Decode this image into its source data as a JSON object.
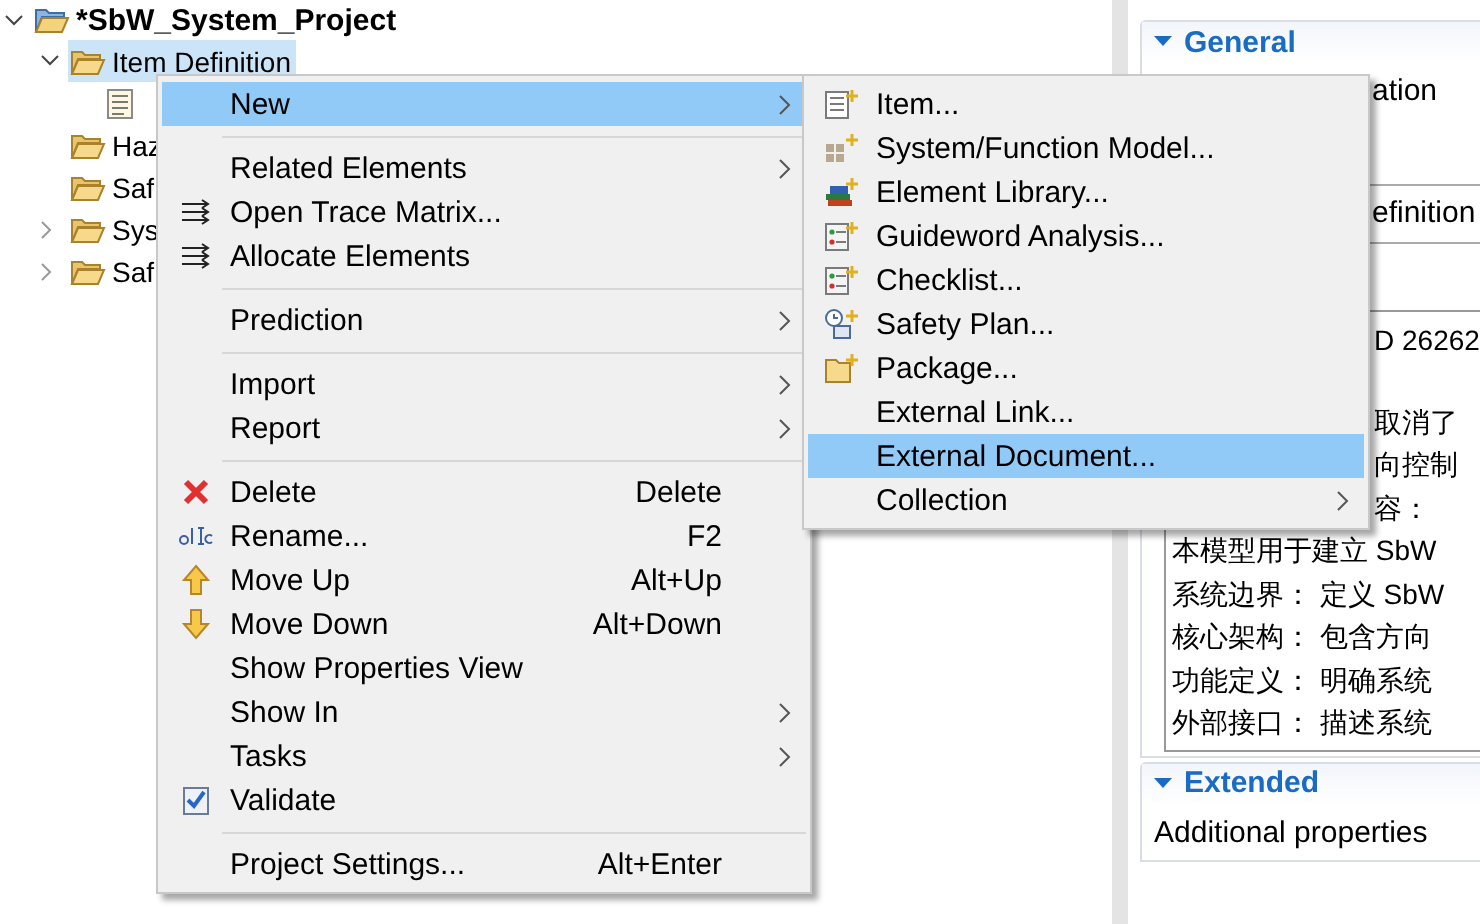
{
  "tree": [
    {
      "label": "*SbW_System_Project",
      "expanded": true,
      "selected": false,
      "kind": "project",
      "children": [
        {
          "label": "Item Definition",
          "expanded": true,
          "selected": true,
          "kind": "folder",
          "children": [
            {
              "selected": false,
              "kind": "document"
            }
          ]
        },
        {
          "label": "Haz",
          "selected": false,
          "kind": "folder"
        },
        {
          "label": "Saf",
          "selected": false,
          "kind": "folder"
        },
        {
          "label": "Sys",
          "expanded": false,
          "selected": false,
          "kind": "folder"
        },
        {
          "label": "Saf",
          "expanded": false,
          "selected": false,
          "kind": "folder"
        }
      ]
    }
  ],
  "properties": {
    "sections": [
      {
        "title": "General",
        "expanded": true,
        "lines": [
          {
            "kind": "text",
            "text": "ation"
          },
          {
            "kind": "field",
            "value": "efinition"
          },
          {
            "kind": "area",
            "lines": [
              "D 26262",
              "取消了",
              "向控制",
              "容：",
              "本模型用于建立 SbW",
              "系统边界：  定义 SbW",
              "核心架构：  包含方向",
              "功能定义：  明确系统",
              "外部接口：  描述系统"
            ]
          }
        ]
      },
      {
        "title": "Extended",
        "expanded": true,
        "lines": [
          {
            "kind": "text",
            "text": "Additional properties"
          }
        ]
      }
    ]
  },
  "context_menu": [
    {
      "kind": "item",
      "label": "New",
      "submenu": true,
      "selected": true
    },
    {
      "kind": "separator"
    },
    {
      "kind": "item",
      "label": "Related Elements",
      "submenu": true,
      "selected": false
    },
    {
      "kind": "item",
      "label": "Open Trace Matrix...",
      "selected": false
    },
    {
      "kind": "item",
      "label": "Allocate Elements",
      "selected": false
    },
    {
      "kind": "separator"
    },
    {
      "kind": "item",
      "label": "Prediction",
      "submenu": true,
      "selected": false
    },
    {
      "kind": "separator"
    },
    {
      "kind": "item",
      "label": "Import",
      "submenu": true,
      "selected": false
    },
    {
      "kind": "item",
      "label": "Report",
      "submenu": true,
      "selected": false
    },
    {
      "kind": "separator"
    },
    {
      "kind": "item",
      "label": "Delete",
      "shortcut": "Delete",
      "selected": false
    },
    {
      "kind": "item",
      "label": "Rename...",
      "shortcut": "F2",
      "selected": false
    },
    {
      "kind": "item",
      "label": "Move Up",
      "shortcut": "Alt+Up",
      "selected": false
    },
    {
      "kind": "item",
      "label": "Move Down",
      "shortcut": "Alt+Down",
      "selected": false
    },
    {
      "kind": "item",
      "label": "Show Properties View",
      "selected": false
    },
    {
      "kind": "item",
      "label": "Show In",
      "submenu": true,
      "selected": false
    },
    {
      "kind": "item",
      "label": "Tasks",
      "submenu": true,
      "selected": false
    },
    {
      "kind": "item",
      "label": "Validate",
      "selected": false
    },
    {
      "kind": "separator"
    },
    {
      "kind": "item",
      "label": "Project Settings...",
      "shortcut": "Alt+Enter",
      "selected": false
    }
  ],
  "submenu": [
    {
      "kind": "item",
      "label": "Item...",
      "selected": false
    },
    {
      "kind": "item",
      "label": "System/Function Model...",
      "selected": false
    },
    {
      "kind": "item",
      "label": "Element Library...",
      "selected": false
    },
    {
      "kind": "item",
      "label": "Guideword Analysis...",
      "selected": false
    },
    {
      "kind": "item",
      "label": "Checklist...",
      "selected": false
    },
    {
      "kind": "item",
      "label": "Safety Plan...",
      "selected": false
    },
    {
      "kind": "item",
      "label": "Package...",
      "selected": false
    },
    {
      "kind": "item",
      "label": "External Link...",
      "selected": false
    },
    {
      "kind": "item",
      "label": "External Document...",
      "selected": true
    },
    {
      "kind": "item",
      "label": "Collection",
      "submenu": true,
      "selected": false
    }
  ]
}
